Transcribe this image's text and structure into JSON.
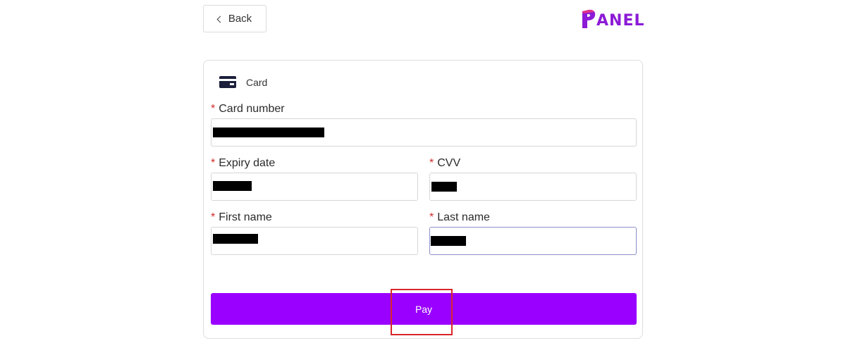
{
  "header": {
    "back_label": "Back",
    "logo_text": "ANEL",
    "logo_initial": "P"
  },
  "payment": {
    "method_label": "Card",
    "required_mark": "*",
    "fields": {
      "card_number": {
        "label": "Card number",
        "value": ""
      },
      "expiry": {
        "label": "Expiry date",
        "value": ""
      },
      "cvv": {
        "label": "CVV",
        "value": ""
      },
      "first_name": {
        "label": "First name",
        "value": ""
      },
      "last_name": {
        "label": "Last name",
        "value": ""
      }
    },
    "pay_label": "Pay"
  },
  "colors": {
    "brand": "#9a00ff",
    "logo": "#8c1ad6",
    "required": "#d12b2b",
    "highlight": "#d9262a"
  },
  "icons": {
    "back": "chevron-left-icon",
    "card": "credit-card-icon"
  }
}
